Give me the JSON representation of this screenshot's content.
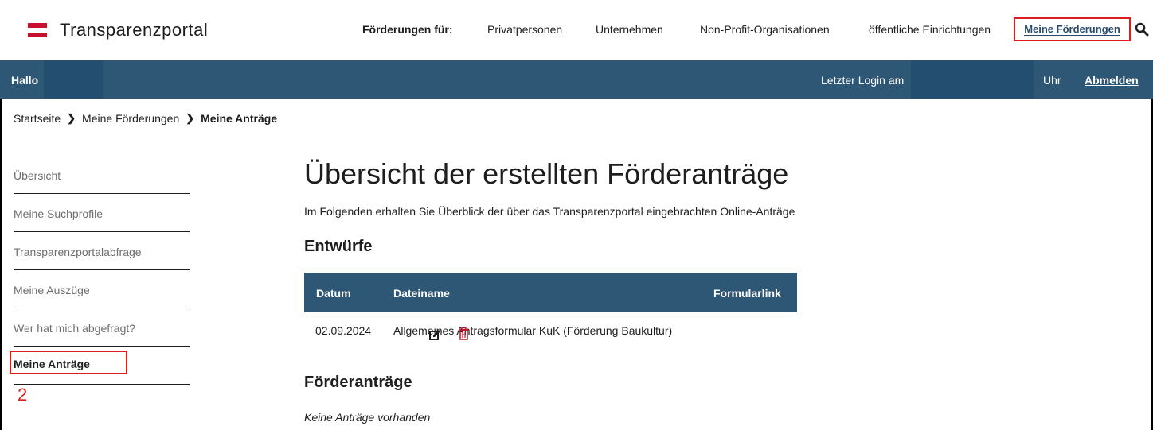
{
  "header": {
    "logo_text": "Transparenzportal",
    "nav_lead": "Förderungen für:",
    "nav_items": [
      "Privatpersonen",
      "Unternehmen",
      "Non-Profit-Organisationen",
      "öffentliche Einrichtungen"
    ],
    "meine_foerderungen": "Meine Förderungen",
    "search_icon": "search-icon"
  },
  "login_bar": {
    "greeting": "Hallo",
    "last_login_label": "Letzter Login am",
    "time_suffix": "Uhr",
    "logout": "Abmelden"
  },
  "breadcrumb": {
    "items": [
      "Startseite",
      "Meine Förderungen",
      "Meine Anträge"
    ]
  },
  "sidebar": {
    "items": [
      {
        "label": "Übersicht"
      },
      {
        "label": "Meine Suchprofile"
      },
      {
        "label": "Transparenzportalabfrage"
      },
      {
        "label": "Meine Auszüge"
      },
      {
        "label": "Wer hat mich abgefragt?"
      },
      {
        "label": "Meine Anträge",
        "active": true
      }
    ],
    "step_number": "2"
  },
  "main": {
    "title": "Übersicht der erstellten Förderanträge",
    "intro": "Im Folgenden erhalten Sie Überblick der über das Transparenzportal eingebrachten Online-Anträge",
    "drafts_heading": "Entwürfe",
    "table": {
      "columns": [
        "Datum",
        "Dateiname",
        "Formularlink"
      ],
      "rows": [
        {
          "date": "02.09.2024",
          "filename": "Allgemeines Antragsformular KuK (Förderung Baukultur)",
          "icons": [
            "edit-icon",
            "trash-icon"
          ]
        }
      ]
    },
    "applications_heading": "Förderanträge",
    "empty_text": "Keine Anträge vorhanden"
  },
  "colors": {
    "primary_bar": "#2e5776",
    "highlight_red": "#d9201f",
    "flag_red": "#c8102e"
  }
}
